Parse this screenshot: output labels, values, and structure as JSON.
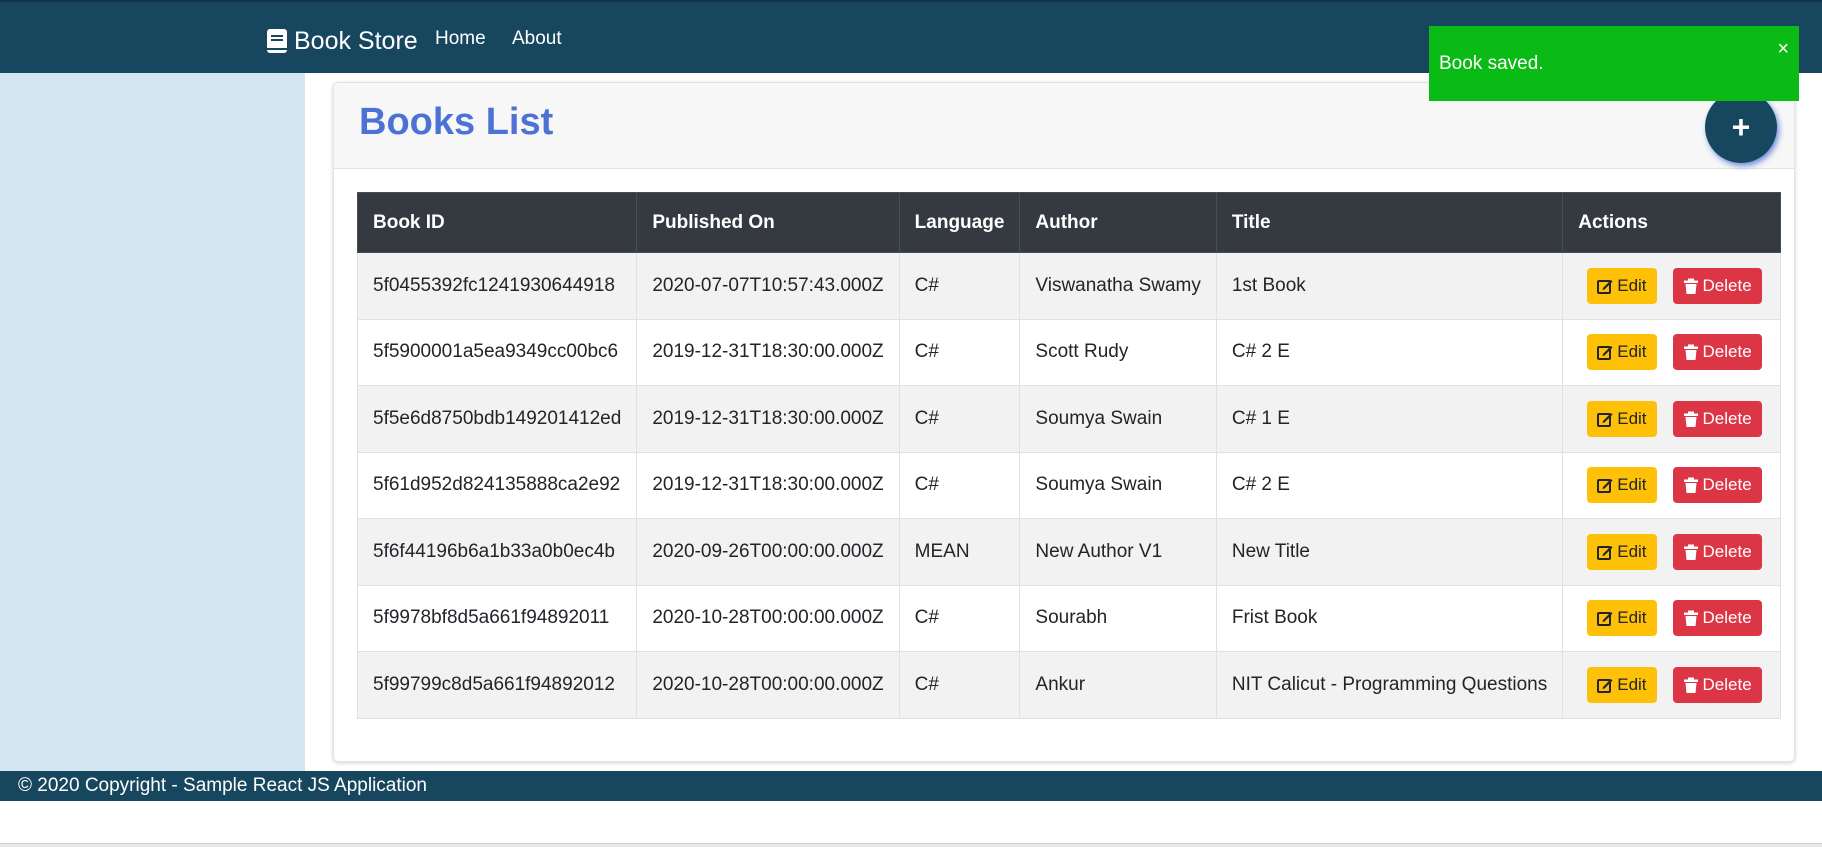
{
  "navbar": {
    "brand": "Book Store",
    "links": [
      {
        "label": "Home"
      },
      {
        "label": "About"
      }
    ]
  },
  "toast": {
    "message": "Book saved.",
    "close": "×"
  },
  "page": {
    "title": "Books List",
    "add_button": "+"
  },
  "table": {
    "headers": [
      "Book ID",
      "Published On",
      "Language",
      "Author",
      "Title",
      "Actions"
    ],
    "rows": [
      {
        "id": "5f0455392fc1241930644918",
        "published": "2020-07-07T10:57:43.000Z",
        "language": "C#",
        "author": "Viswanatha Swamy",
        "title": "1st Book"
      },
      {
        "id": "5f5900001a5ea9349cc00bc6",
        "published": "2019-12-31T18:30:00.000Z",
        "language": "C#",
        "author": "Scott Rudy",
        "title": "C# 2 E"
      },
      {
        "id": "5f5e6d8750bdb149201412ed",
        "published": "2019-12-31T18:30:00.000Z",
        "language": "C#",
        "author": "Soumya Swain",
        "title": "C# 1 E"
      },
      {
        "id": "5f61d952d824135888ca2e92",
        "published": "2019-12-31T18:30:00.000Z",
        "language": "C#",
        "author": "Soumya Swain",
        "title": "C# 2 E"
      },
      {
        "id": "5f6f44196b6a1b33a0b0ec4b",
        "published": "2020-09-26T00:00:00.000Z",
        "language": "MEAN",
        "author": "New Author V1",
        "title": "New Title"
      },
      {
        "id": "5f9978bf8d5a661f94892011",
        "published": "2020-10-28T00:00:00.000Z",
        "language": "C#",
        "author": "Sourabh",
        "title": "Frist Book"
      },
      {
        "id": "5f99799c8d5a661f94892012",
        "published": "2020-10-28T00:00:00.000Z",
        "language": "C#",
        "author": "Ankur",
        "title": "NIT Calicut - Programming Questions"
      }
    ],
    "edit_label": "Edit",
    "delete_label": "Delete"
  },
  "footer": {
    "text": "© 2020 Copyright - Sample React JS Application"
  },
  "colors": {
    "navbar": "#17465f",
    "sidebar": "#d4e6f2",
    "title": "#4c72d6",
    "toast": "#0abb15",
    "edit": "#ffc107",
    "delete": "#dc3545",
    "table_header": "#343a40"
  },
  "icons": {
    "brand": "book-icon",
    "edit": "edit-icon",
    "delete": "trash-icon"
  }
}
